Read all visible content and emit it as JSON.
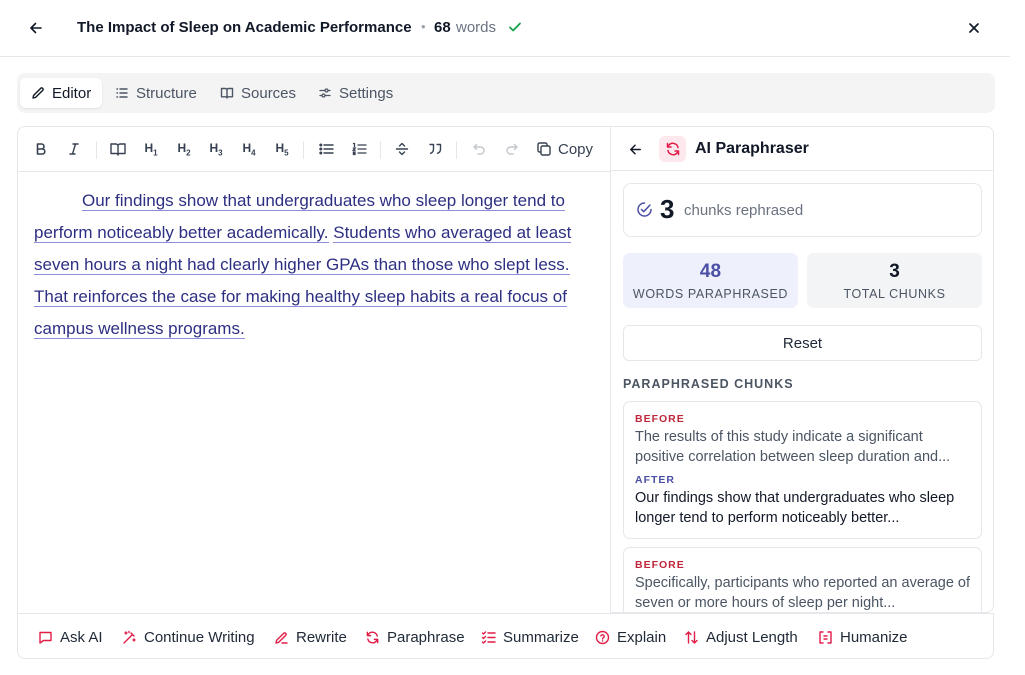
{
  "header": {
    "title": "The Impact of Sleep on Academic Performance",
    "dot": "•",
    "word_count": "68",
    "word_label": "words"
  },
  "tabs": [
    {
      "label": "Editor",
      "icon": "pencil-icon",
      "active": true
    },
    {
      "label": "Structure",
      "icon": "list-icon",
      "active": false
    },
    {
      "label": "Sources",
      "icon": "book-icon",
      "active": false
    },
    {
      "label": "Settings",
      "icon": "sliders-icon",
      "active": false
    }
  ],
  "toolbar": {
    "copy_label": "Copy",
    "headings": [
      {
        "letter": "H",
        "level": "1"
      },
      {
        "letter": "H",
        "level": "2"
      },
      {
        "letter": "H",
        "level": "3"
      },
      {
        "letter": "H",
        "level": "4"
      },
      {
        "letter": "H",
        "level": "5"
      }
    ]
  },
  "editor": {
    "chunks": [
      "Our findings show that undergraduates who sleep longer tend to perform noticeably better academically.",
      "Students who averaged at least seven hours a night had clearly higher GPAs than those who slept less. That reinforces the case for making healthy sleep habits a real focus of campus wellness programs."
    ]
  },
  "paraphraser": {
    "title": "AI Paraphraser",
    "chunks_count": "3",
    "chunks_label": "chunks rephrased",
    "stats": [
      {
        "value": "48",
        "label": "WORDS PARAPHRASED"
      },
      {
        "value": "3",
        "label": "TOTAL CHUNKS"
      }
    ],
    "reset_label": "Reset",
    "section_title": "PARAPHRASED CHUNKS",
    "before_label": "BEFORE",
    "after_label": "AFTER",
    "items": [
      {
        "before": "The results of this study indicate a significant positive correlation between sleep duration and...",
        "after": "Our findings show that undergraduates who sleep longer tend to perform noticeably better..."
      },
      {
        "before": "Specifically, participants who reported an average of seven or more hours of sleep per night..."
      }
    ]
  },
  "actions": [
    {
      "label": "Ask AI",
      "icon": "chat-icon"
    },
    {
      "label": "Continue Writing",
      "icon": "magic-wand-icon"
    },
    {
      "label": "Rewrite",
      "icon": "pen-icon"
    },
    {
      "label": "Paraphrase",
      "icon": "refresh-icon"
    },
    {
      "label": "Summarize",
      "icon": "list-check-icon"
    },
    {
      "label": "Explain",
      "icon": "help-circle-icon"
    },
    {
      "label": "Adjust Length",
      "icon": "arrows-updown-icon"
    },
    {
      "label": "Humanize",
      "icon": "bracket-box-icon"
    }
  ],
  "colors": {
    "accent": "#4b4fa6",
    "danger": "#c0263b",
    "success": "#16a34a",
    "paraphrase_icon": "#e11d48"
  }
}
